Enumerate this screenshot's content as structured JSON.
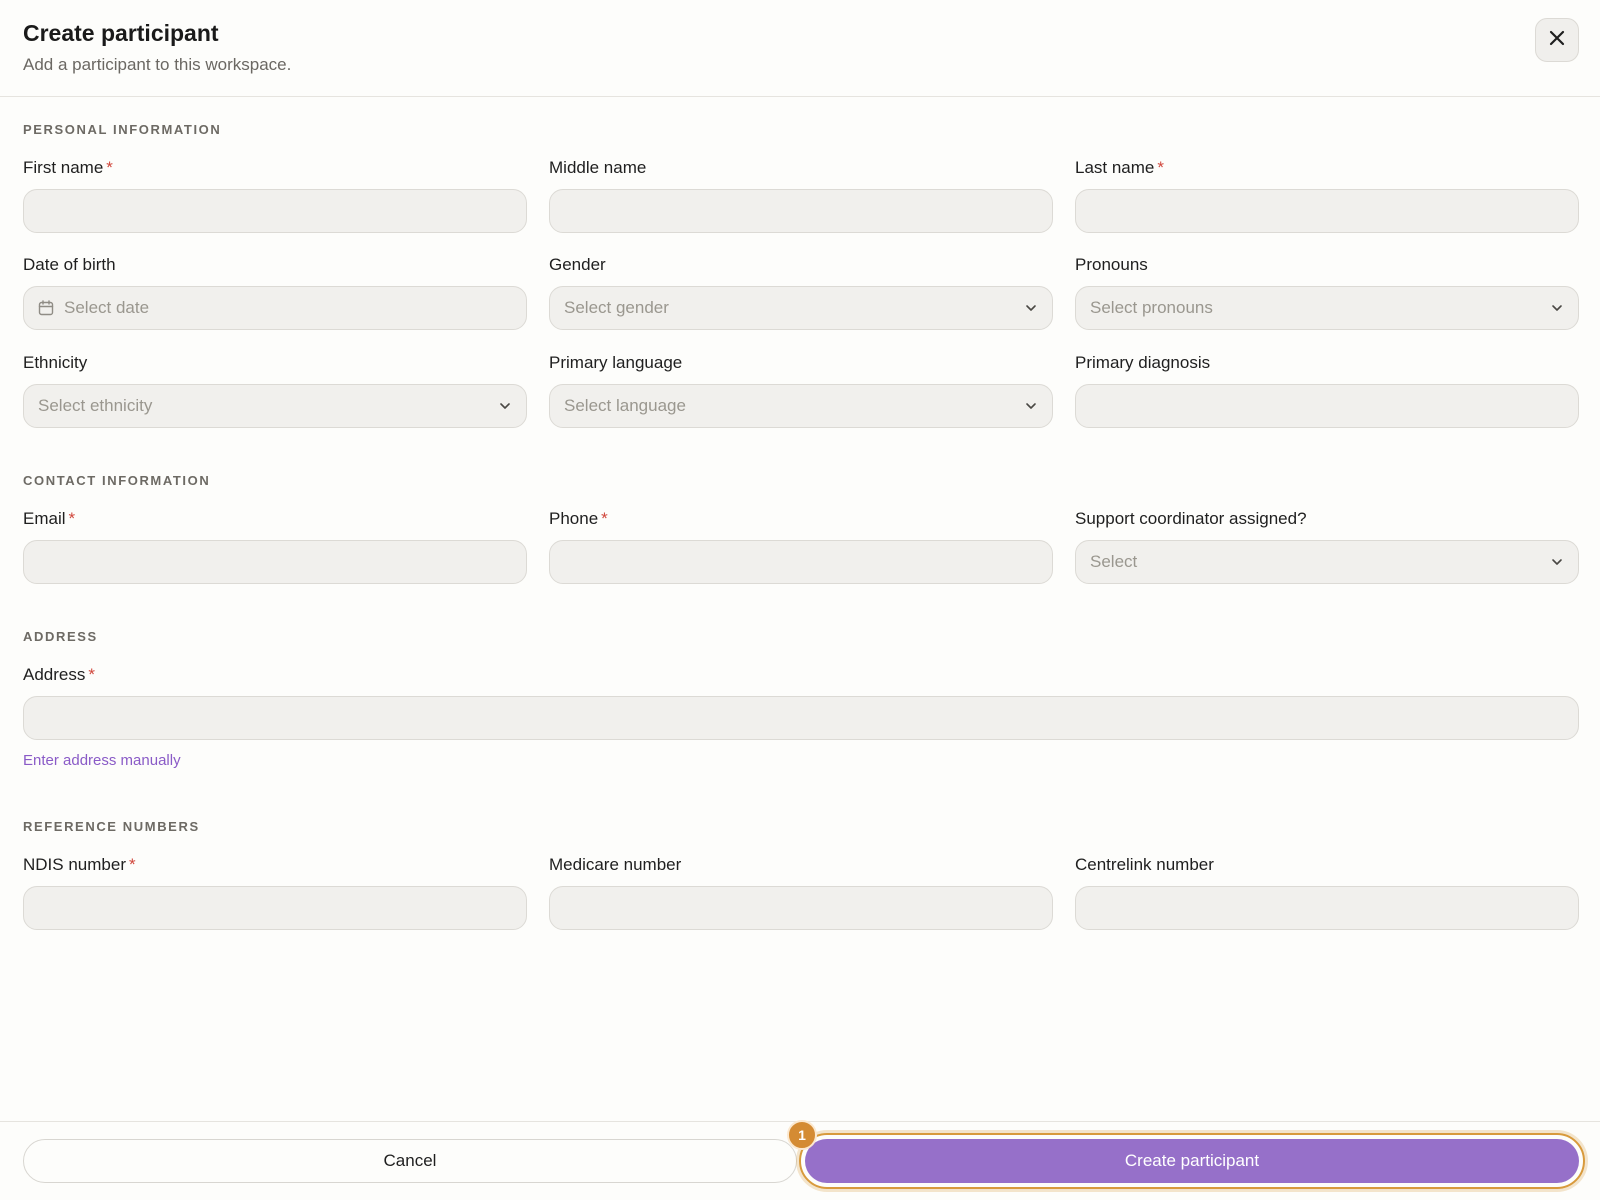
{
  "header": {
    "title": "Create participant",
    "subtitle": "Add a participant to this workspace."
  },
  "sections": {
    "personal": "PERSONAL INFORMATION",
    "contact": "CONTACT INFORMATION",
    "address": "ADDRESS",
    "reference": "REFERENCE NUMBERS"
  },
  "required_marker": "*",
  "fields": {
    "first_name": {
      "label": "First name",
      "value": ""
    },
    "middle_name": {
      "label": "Middle name",
      "value": ""
    },
    "last_name": {
      "label": "Last name",
      "value": ""
    },
    "dob": {
      "label": "Date of birth",
      "placeholder": "Select date"
    },
    "gender": {
      "label": "Gender",
      "placeholder": "Select gender"
    },
    "pronouns": {
      "label": "Pronouns",
      "placeholder": "Select pronouns"
    },
    "ethnicity": {
      "label": "Ethnicity",
      "placeholder": "Select ethnicity"
    },
    "primary_language": {
      "label": "Primary language",
      "placeholder": "Select language"
    },
    "primary_diagnosis": {
      "label": "Primary diagnosis",
      "value": ""
    },
    "email": {
      "label": "Email",
      "value": ""
    },
    "phone": {
      "label": "Phone",
      "value": ""
    },
    "support_coordinator": {
      "label": "Support coordinator assigned?",
      "placeholder": "Select"
    },
    "address": {
      "label": "Address",
      "value": ""
    },
    "ndis": {
      "label": "NDIS number",
      "value": ""
    },
    "medicare": {
      "label": "Medicare number",
      "value": ""
    },
    "centrelink": {
      "label": "Centrelink number",
      "value": ""
    }
  },
  "links": {
    "enter_address_manually": "Enter address manually"
  },
  "footer": {
    "cancel_label": "Cancel",
    "create_label": "Create participant",
    "badge": "1"
  },
  "icons": {
    "close": "close-icon",
    "calendar": "calendar-icon",
    "chevron": "chevron-down-icon"
  },
  "colors": {
    "accent": "#9670c9",
    "link": "#8a5bc7",
    "required": "#d0463b",
    "highlight": "#d89a3c"
  }
}
